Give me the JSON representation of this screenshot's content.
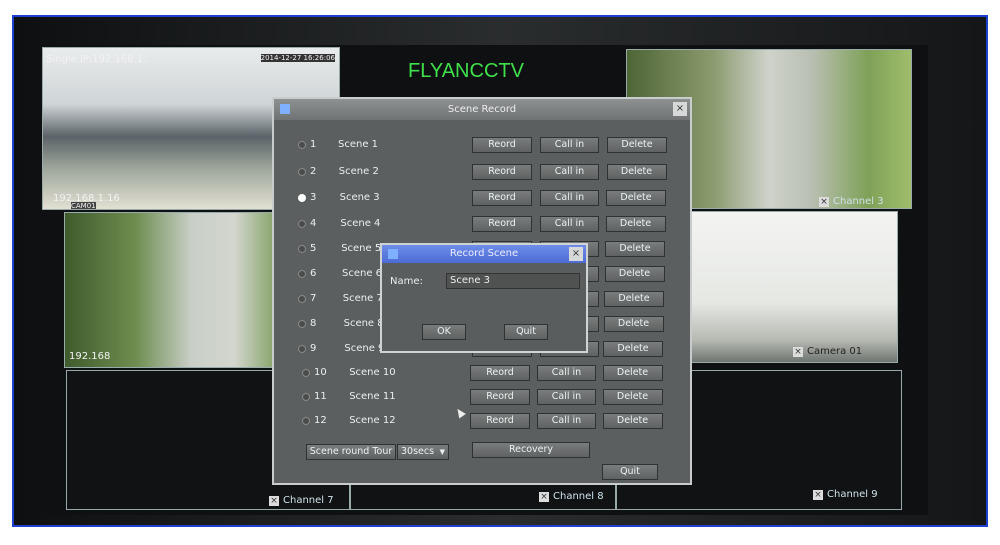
{
  "brand": "FLYANCCTV",
  "tiles": {
    "cam1_top_left": "Single IP:192.168.1.",
    "cam1_timestamp": "2014-12-27 16:26:06",
    "cam1_ip": "192.168.1.16",
    "cam1_name": "CAM01",
    "cam2_ip": "192.168",
    "cam3_label": "Channel 3",
    "cam4_label": "Camera 01",
    "ch7": "Channel 7",
    "ch8": "Channel 8",
    "ch9": "Channel 9"
  },
  "scene_record": {
    "title": "Scene Record",
    "close": "×",
    "record_label": "Reord",
    "callin_label": "Call in",
    "delete_label": "Delete",
    "selected": 3,
    "rows": [
      {
        "num": "1",
        "name": "Scene 1"
      },
      {
        "num": "2",
        "name": "Scene 2"
      },
      {
        "num": "3",
        "name": "Scene 3"
      },
      {
        "num": "4",
        "name": "Scene 4"
      },
      {
        "num": "5",
        "name": "Scene 5"
      },
      {
        "num": "6",
        "name": "Scene 6"
      },
      {
        "num": "7",
        "name": "Scene 7"
      },
      {
        "num": "8",
        "name": "Scene 8"
      },
      {
        "num": "9",
        "name": "Scene 9"
      },
      {
        "num": "10",
        "name": "Scene 10"
      },
      {
        "num": "11",
        "name": "Scene 11"
      },
      {
        "num": "12",
        "name": "Scene 12"
      }
    ],
    "tour_label": "Scene round Tour",
    "tour_value": "30secs",
    "recovery": "Recovery",
    "quit": "Quit"
  },
  "record_scene": {
    "title": "Record Scene",
    "close": "×",
    "name_label": "Name:",
    "name_value": "Scene 3",
    "ok": "OK",
    "quit": "Quit"
  }
}
